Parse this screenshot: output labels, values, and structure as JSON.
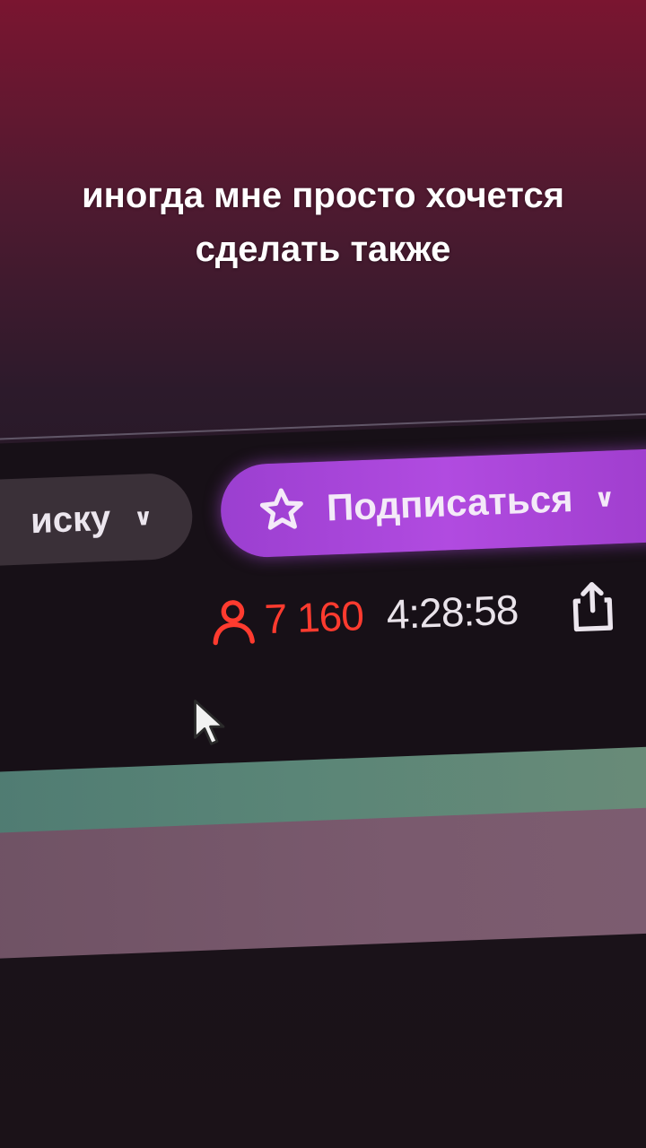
{
  "caption": {
    "line1": "иногда мне просто хочется",
    "line2": "сделать также"
  },
  "stream_bar": {
    "left_pill_text": "иску",
    "left_pill_icon": "chevron-down-icon",
    "subscribe_label": "Подписаться",
    "subscribe_icon": "star-icon",
    "viewer_count": "7 160",
    "viewer_icon": "person-icon",
    "uptime": "4:28:58",
    "share_icon": "share-icon"
  },
  "colors": {
    "subscribe_accent": "#a444d8",
    "viewer_count": "#ff3b2f"
  }
}
